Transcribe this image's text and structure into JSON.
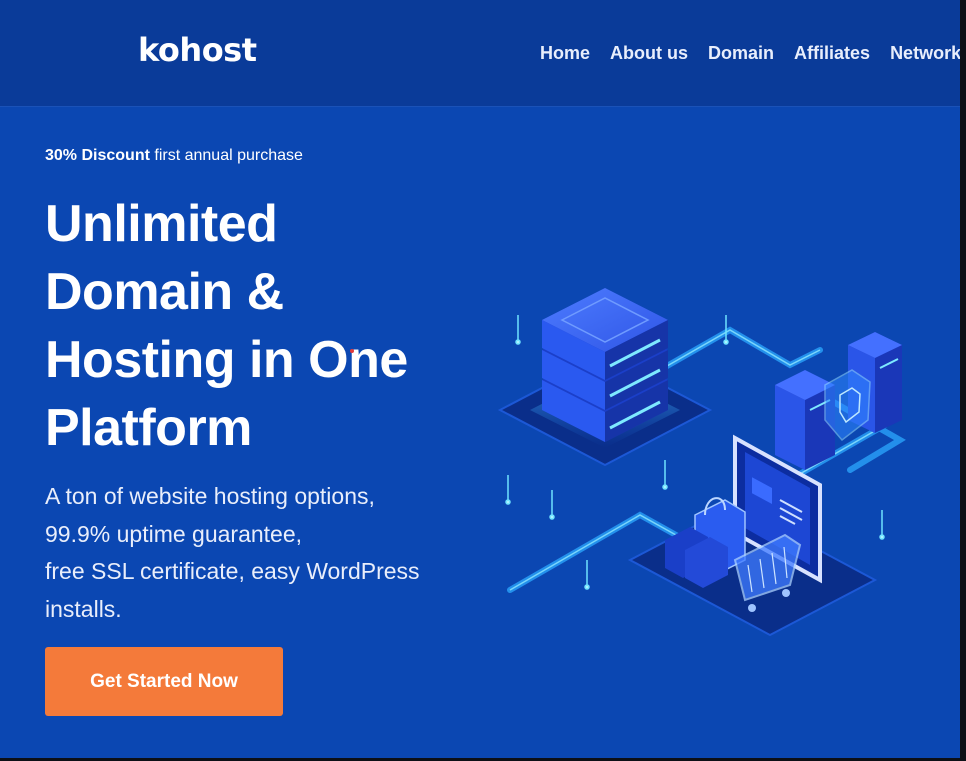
{
  "header": {
    "logo": "kohost",
    "nav": [
      "Home",
      "About us",
      "Domain",
      "Affiliates",
      "Network"
    ]
  },
  "hero": {
    "promo_bold": "30% Discount",
    "promo_rest": "first annual purchase",
    "headline": [
      "Unlimited",
      "Domain &",
      "Hosting in One",
      "Platform"
    ],
    "subtext": [
      "A ton of website hosting options,",
      "99.9% uptime guarantee,",
      "free SSL certificate, easy WordPress",
      "installs."
    ],
    "cta_label": "Get Started Now"
  },
  "colors": {
    "background": "#0b47b2",
    "header": "#0a3b99",
    "accent": "#f47a3a",
    "text": "#ffffff"
  },
  "icons": [
    "server-stack-icon",
    "shopping-cart-icon",
    "shopping-bag-icon",
    "shield-icon",
    "monitor-icon"
  ]
}
